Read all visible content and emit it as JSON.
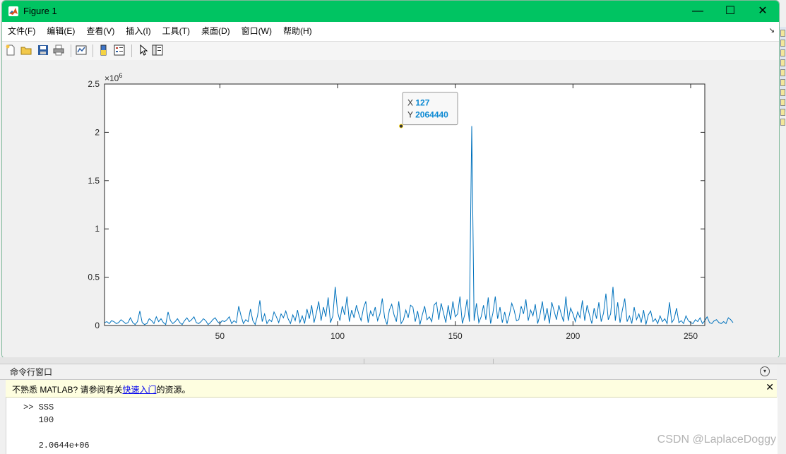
{
  "window": {
    "title": "Figure 1",
    "minimize_glyph": "—",
    "maximize_glyph": "☐",
    "close_glyph": "✕"
  },
  "menu": {
    "items": [
      "文件(F)",
      "编辑(E)",
      "查看(V)",
      "插入(I)",
      "工具(T)",
      "桌面(D)",
      "窗口(W)",
      "帮助(H)"
    ],
    "dock_arrow": "↘"
  },
  "toolbar": {
    "icons": [
      "new-figure-icon",
      "open-file-icon",
      "save-icon",
      "print-icon",
      "link-plot-icon",
      "colorbar-icon",
      "legend-icon",
      "edit-plot-arrow-icon",
      "property-inspector-icon"
    ]
  },
  "chart_data": {
    "type": "line",
    "title": "",
    "xlabel": "",
    "ylabel": "",
    "exponent_label": "×10",
    "exponent_power": "6",
    "xlim": [
      1,
      256
    ],
    "ylim": [
      0,
      2.5
    ],
    "xticks": [
      "50",
      "100",
      "150",
      "200",
      "250"
    ],
    "yticks": [
      "0",
      "0.5",
      "1",
      "1.5",
      "2",
      "2.5"
    ],
    "series_color": "#0072bd",
    "peak": {
      "x": 127,
      "y": 2064440
    },
    "datatip": {
      "x_label": "X",
      "x_value": "127",
      "y_label": "Y",
      "y_value": "2064440"
    },
    "y_values_millions": [
      0.03,
      0.04,
      0.02,
      0.05,
      0.04,
      0.02,
      0.03,
      0.06,
      0.04,
      0.02,
      0.03,
      0.08,
      0.03,
      0.01,
      0.04,
      0.15,
      0.03,
      0.01,
      0.02,
      0.07,
      0.05,
      0.02,
      0.09,
      0.04,
      0.07,
      0.03,
      0.01,
      0.14,
      0.05,
      0.02,
      0.04,
      0.07,
      0.03,
      0.01,
      0.05,
      0.08,
      0.04,
      0.06,
      0.09,
      0.03,
      0.02,
      0.04,
      0.07,
      0.05,
      0.01,
      0.03,
      0.06,
      0.08,
      0.04,
      0.02,
      0.05,
      0.04,
      0.06,
      0.09,
      0.02,
      0.05,
      0.03,
      0.2,
      0.1,
      0.02,
      0.06,
      0.04,
      0.17,
      0.05,
      0.01,
      0.1,
      0.26,
      0.04,
      0.12,
      0.02,
      0.06,
      0.04,
      0.14,
      0.09,
      0.03,
      0.12,
      0.08,
      0.15,
      0.07,
      0.02,
      0.11,
      0.05,
      0.16,
      0.03,
      0.1,
      0.02,
      0.17,
      0.07,
      0.21,
      0.03,
      0.13,
      0.25,
      0.05,
      0.19,
      0.09,
      0.29,
      0.03,
      0.1,
      0.4,
      0.14,
      0.05,
      0.2,
      0.11,
      0.3,
      0.04,
      0.16,
      0.08,
      0.21,
      0.12,
      0.05,
      0.18,
      0.25,
      0.03,
      0.15,
      0.1,
      0.19,
      0.05,
      0.12,
      0.28,
      0.08,
      0.01,
      0.16,
      0.22,
      0.11,
      0.04,
      0.25,
      0.02,
      0.06,
      0.16,
      0.08,
      0.21,
      0.19,
      0.04,
      0.15,
      0.01,
      0.11,
      0.2,
      0.06,
      0.09,
      0.04,
      0.21,
      0.24,
      0.06,
      0.23,
      0.13,
      0.03,
      0.21,
      0.06,
      0.25,
      0.09,
      0.12,
      0.3,
      0.02,
      0.11,
      0.27,
      0.04,
      2.064,
      0.05,
      0.23,
      0.03,
      0.09,
      0.21,
      0.06,
      0.29,
      0.02,
      0.13,
      0.3,
      0.07,
      0.19,
      0.03,
      0.14,
      0.02,
      0.11,
      0.23,
      0.16,
      0.05,
      0.06,
      0.2,
      0.12,
      0.27,
      0.05,
      0.16,
      0.1,
      0.22,
      0.02,
      0.11,
      0.25,
      0.05,
      0.18,
      0.02,
      0.24,
      0.15,
      0.06,
      0.21,
      0.12,
      0.04,
      0.3,
      0.05,
      0.18,
      0.12,
      0.04,
      0.14,
      0.08,
      0.26,
      0.05,
      0.21,
      0.11,
      0.02,
      0.18,
      0.07,
      0.24,
      0.04,
      0.13,
      0.33,
      0.06,
      0.12,
      0.4,
      0.05,
      0.24,
      0.03,
      0.16,
      0.28,
      0.04,
      0.1,
      0.02,
      0.19,
      0.06,
      0.12,
      0.03,
      0.16,
      0.01,
      0.11,
      0.15,
      0.04,
      0.07,
      0.02,
      0.1,
      0.04,
      0.07,
      0.02,
      0.24,
      0.03,
      0.07,
      0.18,
      0.03,
      0.05,
      0.02,
      0.1,
      0.05,
      0.03,
      0.02,
      0.06,
      0.04,
      0.08,
      0.02,
      0.05,
      0.09,
      0.03,
      0.02,
      0.05,
      0.06,
      0.03,
      0.02,
      0.04,
      0.02,
      0.08,
      0.06,
      0.03
    ]
  },
  "command_window": {
    "title": "命令行窗口",
    "collapse_glyph": "▾",
    "info_prefix": "不熟悉 MATLAB? 请参阅有关",
    "info_link": "快速入门",
    "info_suffix": "的资源。",
    "info_close": "✕",
    "lines": [
      ">> SSS",
      "   100",
      "",
      "   2.0644e+06"
    ]
  },
  "watermark": "CSDN @LaplaceDoggy"
}
